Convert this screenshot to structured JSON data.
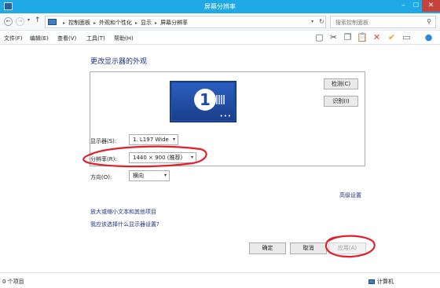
{
  "window": {
    "title": "屏幕分辨率"
  },
  "address": {
    "crumbs": [
      "控制面板",
      "外观和个性化",
      "显示",
      "屏幕分辨率"
    ],
    "search_placeholder": "搜索控制面板"
  },
  "menu": {
    "items": [
      "文件(F)",
      "编辑(E)",
      "查看(V)",
      "工具(T)",
      "帮助(H)"
    ]
  },
  "toolbar": {
    "icons": [
      "layout-icon",
      "cut-icon",
      "copy-icon",
      "paste-icon",
      "delete-icon",
      "check-icon",
      "properties-icon",
      "help-icon"
    ],
    "colors": {
      "delete": "#e0433a",
      "check": "#f0a020",
      "help": "#2a8ad8"
    }
  },
  "content": {
    "heading": "更改显示器的外观",
    "monitor_number": "1",
    "detect_label": "检测(C)",
    "identify_label": "识别(I)",
    "display_label": "显示器(S):",
    "display_value": "1. L197 Wide",
    "resolution_label": "分辨率(R):",
    "resolution_value": "1440 × 900 (推荐)",
    "orientation_label": "方向(O):",
    "orientation_value": "横向",
    "advanced_link": "高级设置",
    "link_text_size": "放大或缩小文本和其他项目",
    "link_which": "我应该选择什么显示器设置?"
  },
  "buttons": {
    "ok": "确定",
    "cancel": "取消",
    "apply": "应用(A)"
  },
  "status": {
    "count": "0 个项目",
    "computer": "计算机"
  },
  "colors": {
    "titlebar": "#1ea9e6",
    "link": "#1e3287",
    "annotation": "#e0202a"
  }
}
